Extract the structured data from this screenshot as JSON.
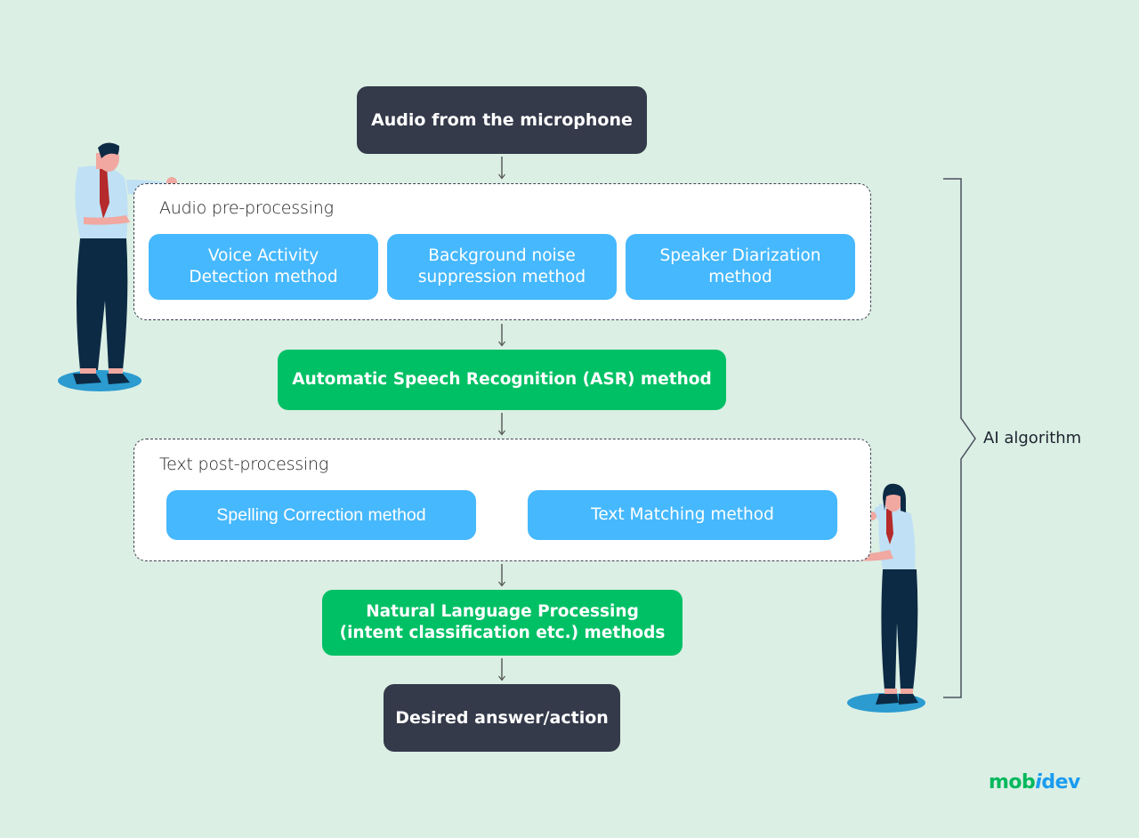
{
  "diagram": {
    "source_node": {
      "label": "Audio from the microphone"
    },
    "audio_preprocessing": {
      "title": "Audio pre-processing",
      "methods": [
        {
          "label": "Voice Activity Detection method",
          "line1": "Voice Activity",
          "line2": "Detection method"
        },
        {
          "label": "Background noise suppression method",
          "line1": "Background noise",
          "line2": "suppression method"
        },
        {
          "label": "Speaker Diarization method",
          "line1": "Speaker Diarization",
          "line2": "method"
        }
      ]
    },
    "asr_node": {
      "label": "Automatic Speech Recognition (ASR) method"
    },
    "text_postprocessing": {
      "title": "Text post-processing",
      "methods": [
        {
          "label": "Spelling Correction method"
        },
        {
          "label": "Text Matching method"
        }
      ]
    },
    "nlp_node": {
      "line1": "Natural Language Processing",
      "line2": "(intent classification etc.) methods"
    },
    "output_node": {
      "label": "Desired answer/action"
    },
    "brace": {
      "label": "AI algorithm"
    }
  },
  "brand": {
    "part1": "mob",
    "part2": "i",
    "part3": "dev"
  },
  "colors": {
    "background": "#dbefe4",
    "dark_node": "#343a4a",
    "green_node": "#00c065",
    "blue_node": "#46b8fd",
    "logo_green": "#00b85c",
    "logo_blue": "#1a9cf0"
  }
}
